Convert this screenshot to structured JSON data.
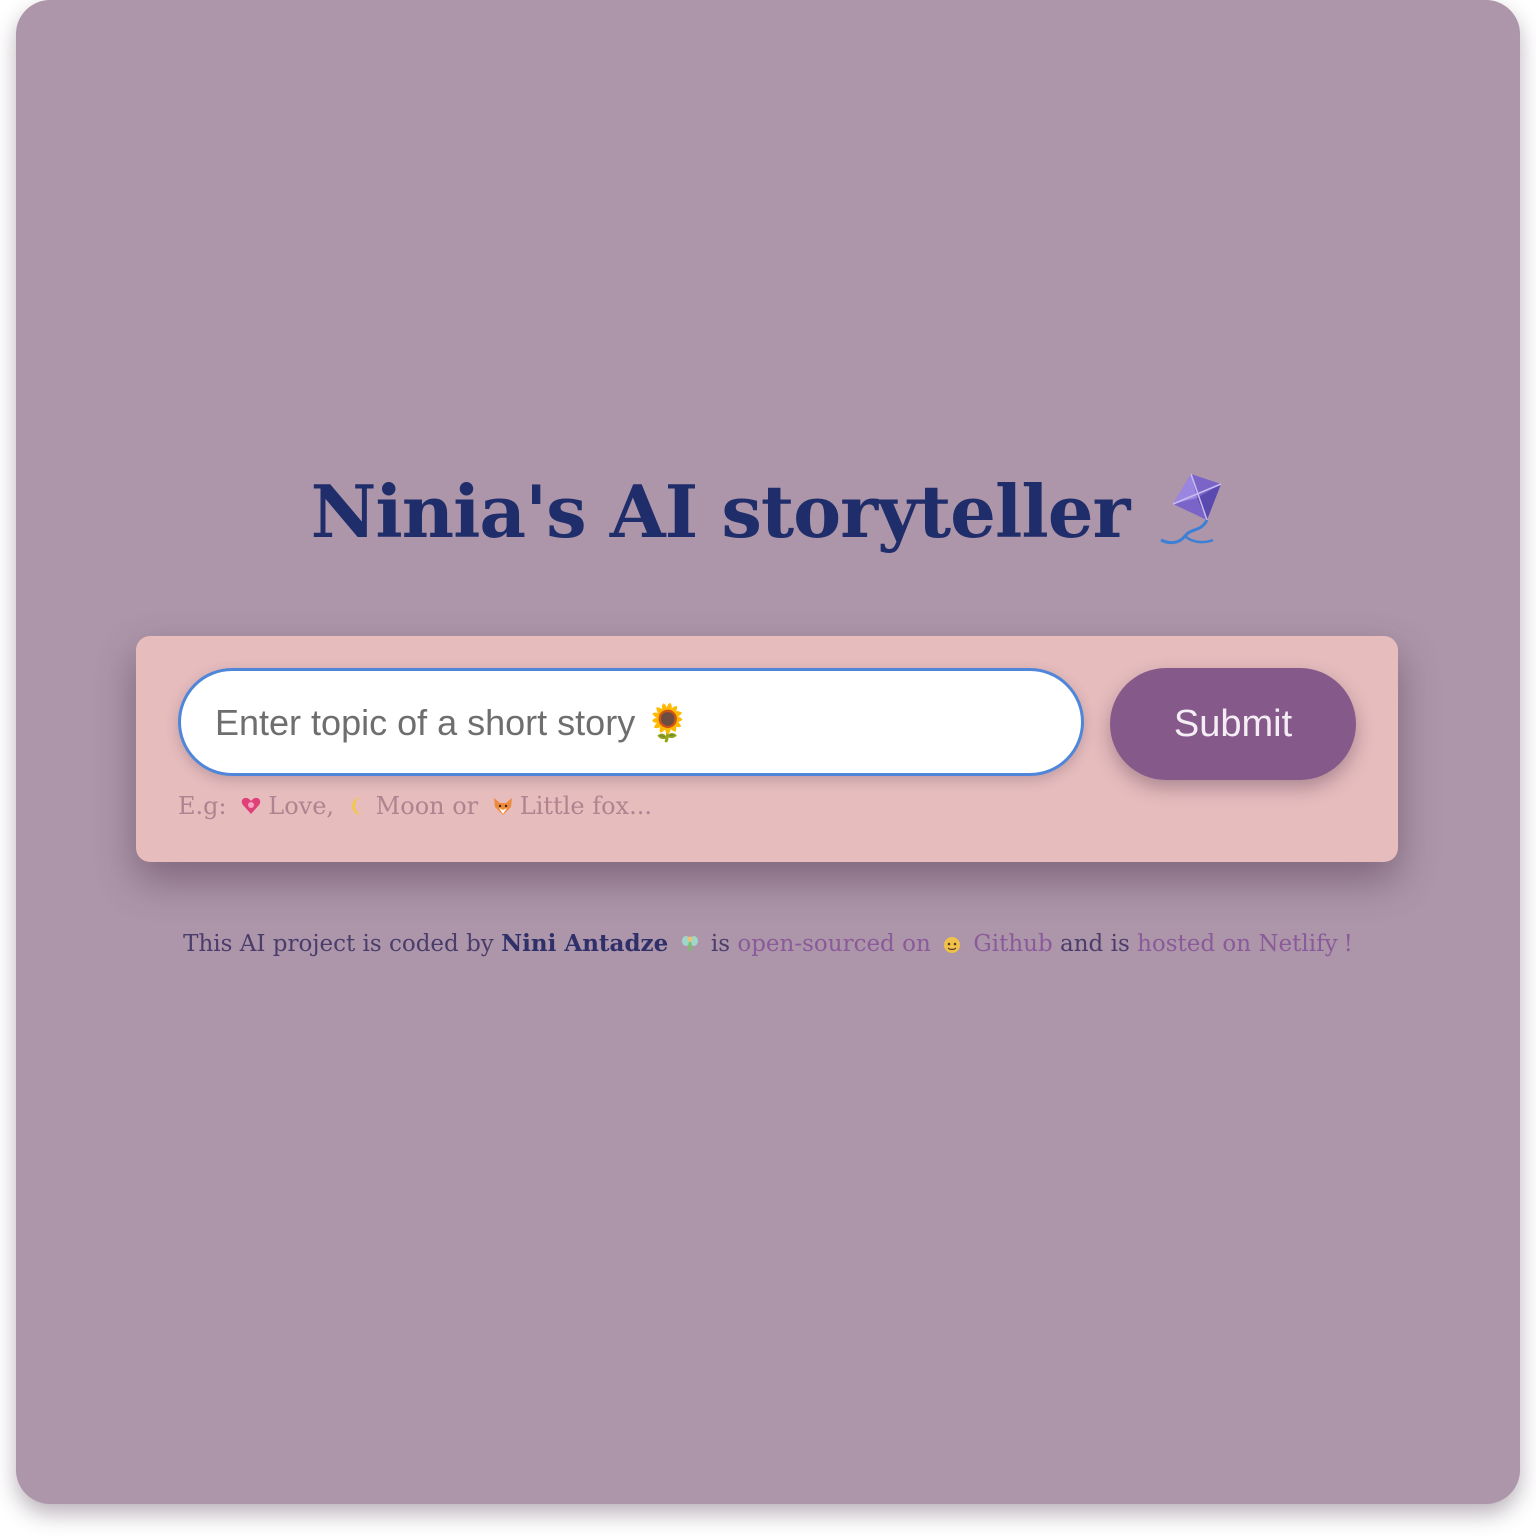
{
  "app": {
    "title": "Ninia's AI storyteller"
  },
  "icons": {
    "title_icon": "kite-icon",
    "input_icon": "sunflower-icon",
    "love_icon": "heart-icon",
    "moon_icon": "moon-icon",
    "fox_icon": "fox-icon",
    "author_icon": "fairy-icon",
    "github_icon": "octocat-icon"
  },
  "form": {
    "input_placeholder": "Enter topic of a short story 🌻",
    "input_value": "",
    "submit_label": "Submit",
    "hint_prefix": "E.g:",
    "hint_love": "Love,",
    "hint_moon": "Moon or",
    "hint_fox": "Little fox..."
  },
  "footer": {
    "text1": "This AI project is coded by",
    "author": "Nini Antadze",
    "text2": "is",
    "open_sourced_link": "open-sourced on",
    "github_link": "Github",
    "text3": "and is",
    "netlify_link": "hosted on Netlify",
    "text4": "!"
  },
  "colors": {
    "background": "#ad96a9",
    "title": "#1f2d6b",
    "card": "#e6bcbd",
    "button": "#855a8b",
    "link": "#8a5a9a",
    "input_border": "#4f86d9"
  }
}
